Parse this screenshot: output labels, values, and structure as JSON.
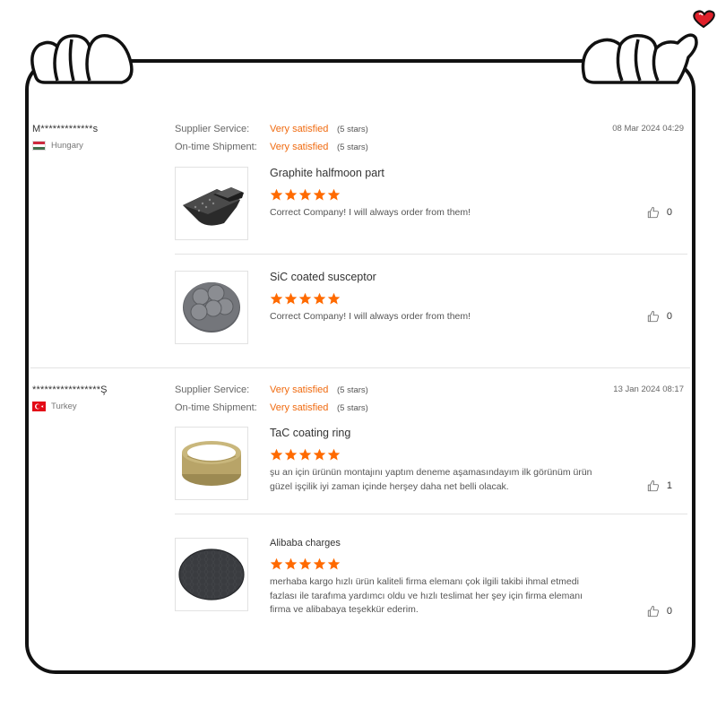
{
  "reviews": [
    {
      "user": "M*************s",
      "country": "Hungary",
      "supplier_service_label": "Supplier Service:",
      "supplier_service_value": "Very satisfied",
      "supplier_service_stars": "(5 stars)",
      "shipment_label": "On-time Shipment:",
      "shipment_value": "Very satisfied",
      "shipment_stars": "(5 stars)",
      "date": "08 Mar 2024 04:29",
      "items": [
        {
          "name": "Graphite halfmoon part",
          "rating": 5,
          "comment": "Correct Company! I will always order from them!",
          "likes": "0",
          "image": "graphite-halfmoon-part"
        },
        {
          "name": "SiC coated susceptor",
          "rating": 5,
          "comment": "Correct Company! I will always order from them!",
          "likes": "0",
          "image": "sic-coated-susceptor"
        }
      ]
    },
    {
      "user": "*****************Ş",
      "country": "Turkey",
      "supplier_service_label": "Supplier Service:",
      "supplier_service_value": "Very satisfied",
      "supplier_service_stars": "(5 stars)",
      "shipment_label": "On-time Shipment:",
      "shipment_value": "Very satisfied",
      "shipment_stars": "(5 stars)",
      "date": "13 Jan 2024 08:17",
      "items": [
        {
          "name": "TaC coating ring",
          "rating": 5,
          "comment": "şu an için ürünün montajını yaptım deneme aşamasındayım ilk görünüm ürün güzel işçilik iyi zaman içinde herşey daha net  belli olacak.",
          "likes": "1",
          "image": "tac-coating-ring"
        },
        {
          "name": "Alibaba charges",
          "rating": 5,
          "comment": "merhaba kargo hızlı ürün kaliteli firma elemanı çok ilgili takibi ihmal etmedi fazlası ile tarafıma yardımcı oldu ve hızlı teslimat her şey için firma elemanı firma ve alibabaya teşekkür ederim.",
          "likes": "0",
          "image": "dark-embossed-disk"
        }
      ]
    }
  ],
  "colors": {
    "accent": "#f06a0f",
    "star": "#ff6a00",
    "frame": "#111111",
    "heart": "#e0202a"
  }
}
